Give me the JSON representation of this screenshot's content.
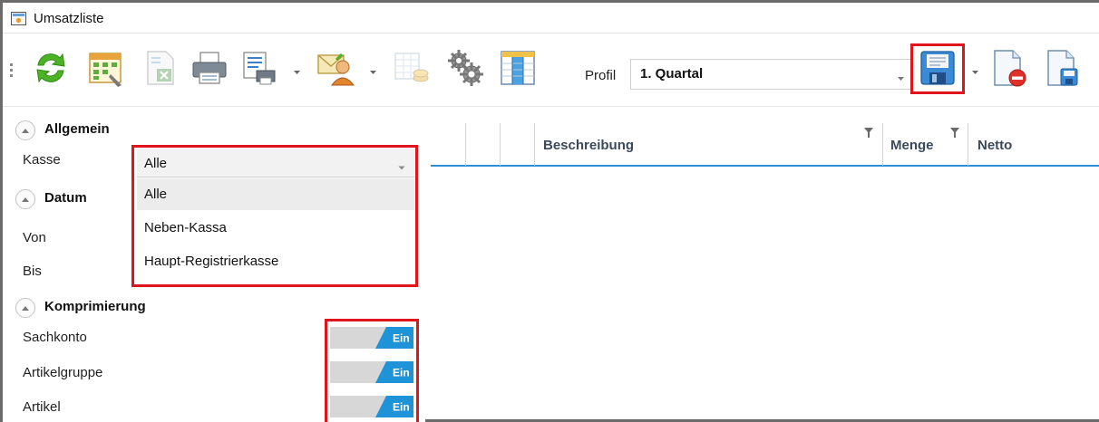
{
  "window": {
    "title": "Umsatzliste"
  },
  "toolbar": {
    "buttons": [
      {
        "name": "refresh-icon"
      },
      {
        "name": "calendar-grid-icon"
      },
      {
        "name": "excel-export-icon",
        "disabled": true
      },
      {
        "name": "print-icon"
      },
      {
        "name": "print-options-icon",
        "has_dropdown": true
      },
      {
        "name": "email-user-icon",
        "has_dropdown": true
      },
      {
        "name": "spreadsheet-coins-icon",
        "disabled": true
      },
      {
        "name": "settings-gears-icon"
      },
      {
        "name": "columns-icon"
      }
    ],
    "profile_label": "Profil",
    "profile_value": "1. Quartal",
    "profile_buttons": [
      {
        "name": "save-profile-icon",
        "has_dropdown": true,
        "highlighted": true
      },
      {
        "name": "delete-profile-icon"
      },
      {
        "name": "save-as-profile-icon"
      }
    ]
  },
  "filters": {
    "sections": {
      "allgemein": "Allgemein",
      "datum": "Datum",
      "komprimierung": "Komprimierung"
    },
    "kasse_label": "Kasse",
    "kasse_value": "Alle",
    "kasse_options": [
      "Alle",
      "Neben-Kassa",
      "Haupt-Registrierkasse"
    ],
    "von_label": "Von",
    "bis_label": "Bis",
    "toggles": [
      {
        "label": "Sachkonto",
        "state": "Ein"
      },
      {
        "label": "Artikelgruppe",
        "state": "Ein"
      },
      {
        "label": "Artikel",
        "state": "Ein"
      }
    ]
  },
  "grid": {
    "columns": [
      "Beschreibung",
      "Menge",
      "Netto"
    ]
  },
  "colors": {
    "highlight": "#e0141c",
    "accent_blue": "#2f8fd6",
    "toggle_blue": "#1e93d8"
  }
}
